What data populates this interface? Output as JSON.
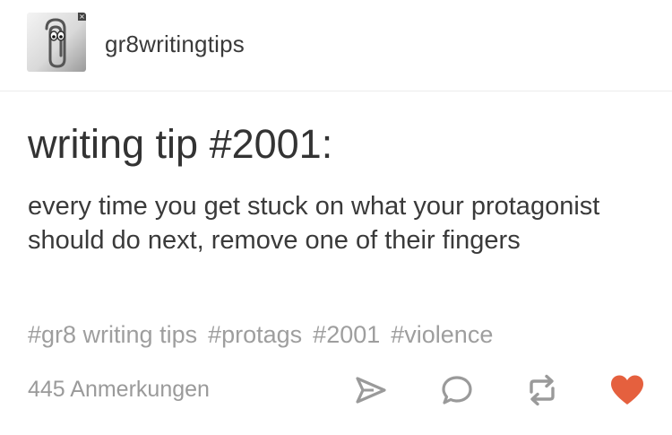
{
  "post": {
    "username": "gr8writingtips",
    "title": "writing tip #2001:",
    "body": "every time you get stuck on what your protagonist should do next, remove one of their fingers",
    "tags": [
      "#gr8 writing tips",
      "#protags",
      "#2001",
      "#violence"
    ],
    "notes": "445 Anmerkungen"
  },
  "actions": {
    "share_icon": "paper-plane-icon",
    "reply_icon": "speech-bubble-icon",
    "reblog_icon": "reblog-arrows-icon",
    "like_icon": "heart-icon"
  },
  "colors": {
    "like": "#e5603e",
    "icon_gray": "#9a9a9a",
    "tag_gray": "#9e9e9e",
    "text": "#333333"
  }
}
